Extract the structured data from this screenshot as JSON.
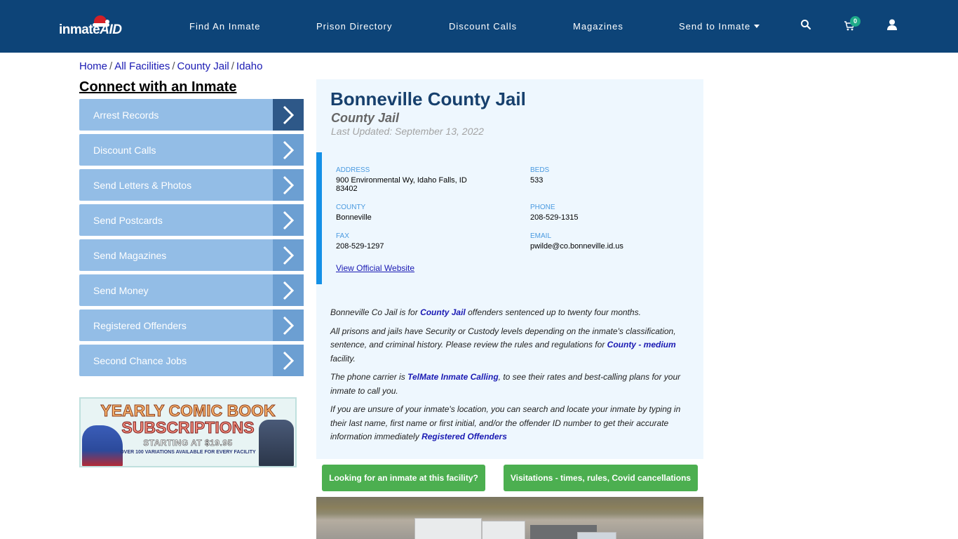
{
  "header": {
    "logo_text_main": "inmate",
    "logo_text_accent": "AID",
    "nav": [
      "Find An Inmate",
      "Prison Directory",
      "Discount Calls",
      "Magazines",
      "Send to Inmate"
    ],
    "icons": {
      "search": "search-icon",
      "cart": "cart-icon",
      "user": "user-icon"
    },
    "cart_count": "0"
  },
  "breadcrumb": [
    "Home",
    "All Facilities",
    "County Jail",
    "Idaho"
  ],
  "breadcrumb_sep": "/",
  "sidebar": {
    "title": "Connect with an Inmate",
    "items": [
      {
        "label": "Arrest Records"
      },
      {
        "label": "Discount Calls"
      },
      {
        "label": "Send Letters & Photos"
      },
      {
        "label": "Send Postcards"
      },
      {
        "label": "Send Magazines"
      },
      {
        "label": "Send Money"
      },
      {
        "label": "Registered Offenders"
      },
      {
        "label": "Second Chance Jobs"
      }
    ],
    "ad": {
      "line1": "YEARLY COMIC BOOK",
      "line2": "SUBSCRIPTIONS",
      "line3": "STARTING AT $19.95",
      "line4": "OVER 100 VARIATIONS AVAILABLE FOR EVERY FACILITY"
    }
  },
  "facility": {
    "name": "Bonneville County Jail",
    "type": "County Jail",
    "last_updated": "Last Updated: September 13, 2022",
    "fields": {
      "address_label": "ADDRESS",
      "address_line1": "900 Environmental Wy, Idaho Falls, ID",
      "address_line2": "83402",
      "beds_label": "BEDS",
      "beds": "533",
      "county_label": "COUNTY",
      "county": "Bonneville",
      "phone_label": "PHONE",
      "phone": "208-529-1315",
      "fax_label": "FAX",
      "fax": "208-529-1297",
      "email_label": "EMAIL",
      "email": "pwilde@co.bonneville.id.us"
    },
    "website_link": "View Official Website",
    "description": {
      "p1_a": "Bonneville Co Jail is for ",
      "p1_link": "County Jail",
      "p1_b": " offenders sentenced up to twenty four months.",
      "p2_a": "All prisons and jails have Security or Custody levels depending on the inmate's classification, sentence, and criminal history. Please review the rules and regulations for ",
      "p2_link": "County - medium",
      "p2_b": " facility.",
      "p3_a": "The phone carrier is ",
      "p3_link": "TelMate Inmate Calling",
      "p3_b": ", to see their rates and best-calling plans for your inmate to call you.",
      "p4_a": "If you are unsure of your inmate's location, you can search and locate your inmate by typing in their last name, first name or first initial, and/or the offender ID number to get their accurate information immediately ",
      "p4_link": "Registered Offenders"
    },
    "buttons": {
      "find_inmate": "Looking for an inmate at this facility?",
      "visitations": "Visitations - times, rules, Covid cancellations"
    }
  },
  "colors": {
    "header_bg": "#0d4478",
    "sidebar_item": "#93bde6",
    "sidebar_arrow": "#6c9fd2",
    "sidebar_arrow_active": "#2e5888",
    "panel_bg": "#eef7fe",
    "accent_bar": "#1490e6",
    "title": "#17406d",
    "button_green": "#4caf50",
    "link": "#1a1ab3"
  }
}
